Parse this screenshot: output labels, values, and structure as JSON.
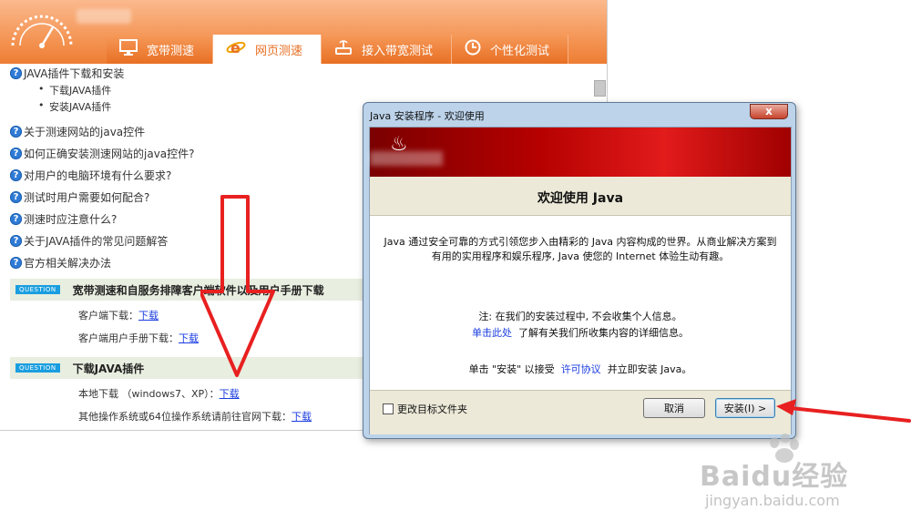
{
  "site": {
    "tabs": [
      {
        "label": "宽带测速",
        "icon": "monitor-icon",
        "active": false
      },
      {
        "label": "网页测速",
        "icon": "ie-icon",
        "active": true
      },
      {
        "label": "接入带宽测试",
        "icon": "router-icon",
        "active": false
      },
      {
        "label": "个性化测试",
        "icon": "clock-icon",
        "active": false
      }
    ],
    "faq": [
      "JAVA插件下载和安装",
      "关于测速网站的java控件",
      "如何正确安装测速网站的java控件?",
      "对用户的电脑环境有什么要求?",
      "测试时用户需要如何配合?",
      "测速时应注意什么?",
      "关于JAVA插件的常见问题解答",
      "官方相关解决办法"
    ],
    "faq_sub": [
      "下载JAVA插件",
      "安装JAVA插件"
    ],
    "question_tag": "QUESTION",
    "section1": {
      "title": "宽带测速和自服务排障客户端软件以及用户手册下载",
      "client_label": "客户端下载：",
      "manual_label": "客户端用户手册下载：",
      "link": "下载"
    },
    "section2": {
      "title": "下载JAVA插件",
      "local_label": "本地下载 （windows7、XP）：",
      "other_label": "其他操作系统或64位操作系统请前往官网下载：",
      "link": "下载"
    }
  },
  "dialog": {
    "title": "Java 安装程序 - 欢迎使用",
    "close": "x",
    "heading": "欢迎使用 Java",
    "intro": "Java 通过安全可靠的方式引领您步入由精彩的 Java 内容构成的世界。从商业解决方案到有用的实用程序和娱乐程序, Java 使您的 Internet 体验生动有趣。",
    "note": "注: 在我们的安装过程中, 不会收集个人信息。",
    "click_here": "单击此处",
    "click_here_rest": "了解有关我们所收集内容的详细信息。",
    "accept_pre": "单击 \"安装\" 以接受",
    "license": "许可协议",
    "accept_post": "并立即安装 Java。",
    "checkbox_label": "更改目标文件夹",
    "cancel": "取消",
    "install": "安装(I) >"
  },
  "watermark": {
    "logo": "Baidu经验",
    "url": "jingyan.baidu.com"
  },
  "colors": {
    "accent_orange": "#ee7d34",
    "java_red": "#c40000",
    "link_blue": "#1a3ce0",
    "annotation_red": "#e82020"
  }
}
